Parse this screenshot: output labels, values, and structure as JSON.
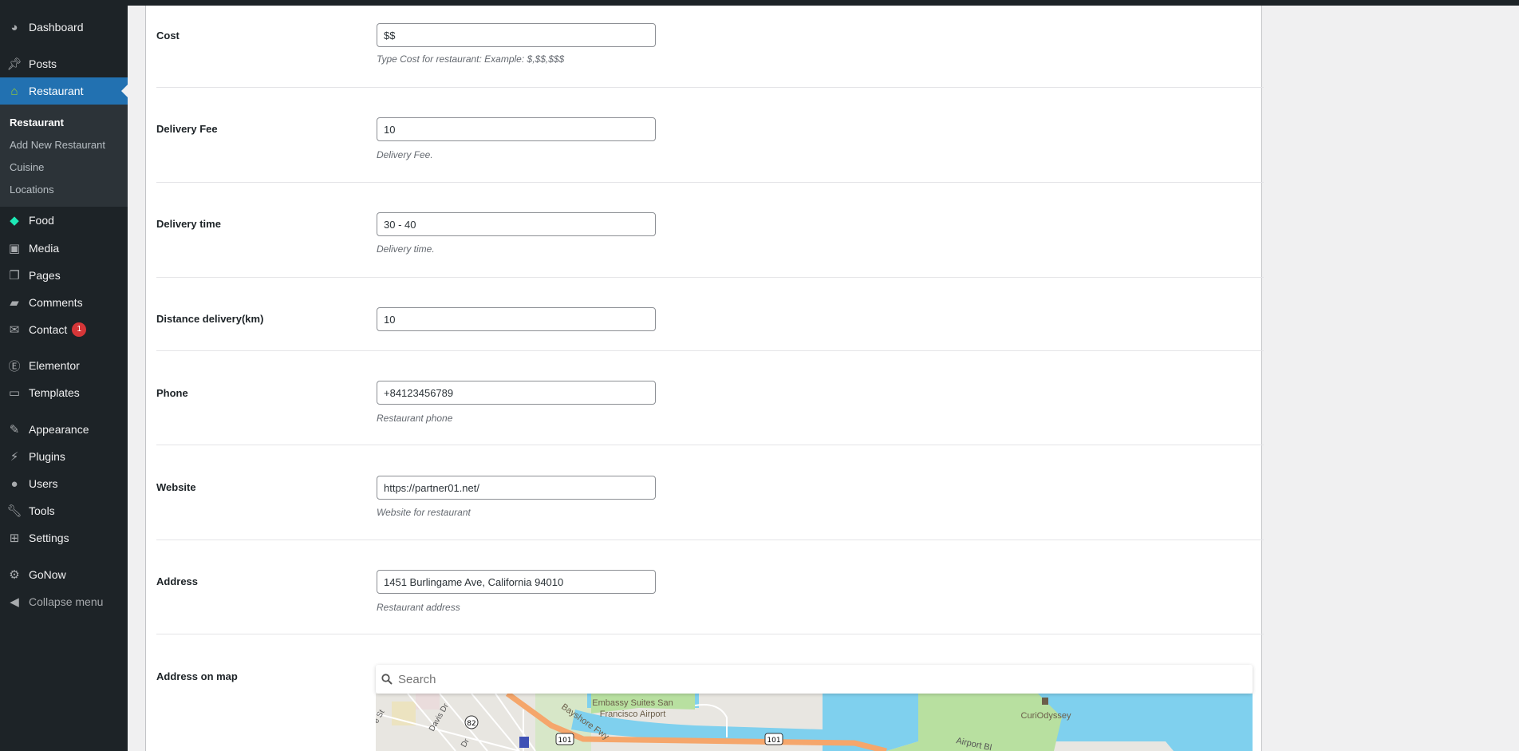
{
  "sidebar": {
    "items": [
      {
        "label": "Dashboard",
        "icon": "dashboard-icon"
      },
      {
        "label": "Posts",
        "icon": "pin-icon"
      },
      {
        "label": "Restaurant",
        "icon": "home-icon"
      },
      {
        "label": "Food",
        "icon": "carrot-icon"
      },
      {
        "label": "Media",
        "icon": "media-icon"
      },
      {
        "label": "Pages",
        "icon": "pages-icon"
      },
      {
        "label": "Comments",
        "icon": "comment-icon"
      },
      {
        "label": "Contact",
        "icon": "mail-icon",
        "badge": "1"
      },
      {
        "label": "Elementor",
        "icon": "elementor-icon"
      },
      {
        "label": "Templates",
        "icon": "folder-icon"
      },
      {
        "label": "Appearance",
        "icon": "brush-icon"
      },
      {
        "label": "Plugins",
        "icon": "plug-icon"
      },
      {
        "label": "Users",
        "icon": "user-icon"
      },
      {
        "label": "Tools",
        "icon": "wrench-icon"
      },
      {
        "label": "Settings",
        "icon": "sliders-icon"
      },
      {
        "label": "GoNow",
        "icon": "gear-icon"
      },
      {
        "label": "Collapse menu",
        "icon": "collapse-icon"
      }
    ],
    "submenu": [
      "Restaurant",
      "Add New Restaurant",
      "Cuisine",
      "Locations"
    ],
    "accent": "#2271b1"
  },
  "form": {
    "fields": [
      {
        "label": "Cost",
        "value": "$$",
        "desc": "Type Cost for restaurant: Example: $,$$,$$$"
      },
      {
        "label": "Delivery Fee",
        "value": "10",
        "desc": "Delivery Fee."
      },
      {
        "label": "Delivery time",
        "value": "30 - 40",
        "desc": "Delivery time."
      },
      {
        "label": "Distance delivery(km)",
        "value": "10"
      },
      {
        "label": "Phone",
        "value": "+84123456789",
        "desc": "Restaurant phone"
      },
      {
        "label": "Website",
        "value": "https://partner01.net/",
        "desc": "Website for restaurant"
      },
      {
        "label": "Address",
        "value": "1451 Burlingame Ave, California 94010",
        "desc": "Restaurant address"
      }
    ],
    "map_label": "Address on map",
    "map_search_placeholder": "Search",
    "map_labels": {
      "poi1": "Embassy Suites San",
      "poi1b": "Francisco Airport",
      "poi2": "CuriOdyssey",
      "road1": "Bayshore Fwy",
      "road2": "Davis Dr",
      "road3": "Airport Bl",
      "road4": "Dr",
      "road5": "e St",
      "shield1": "101",
      "shield2": "101",
      "shield3": "82"
    }
  }
}
